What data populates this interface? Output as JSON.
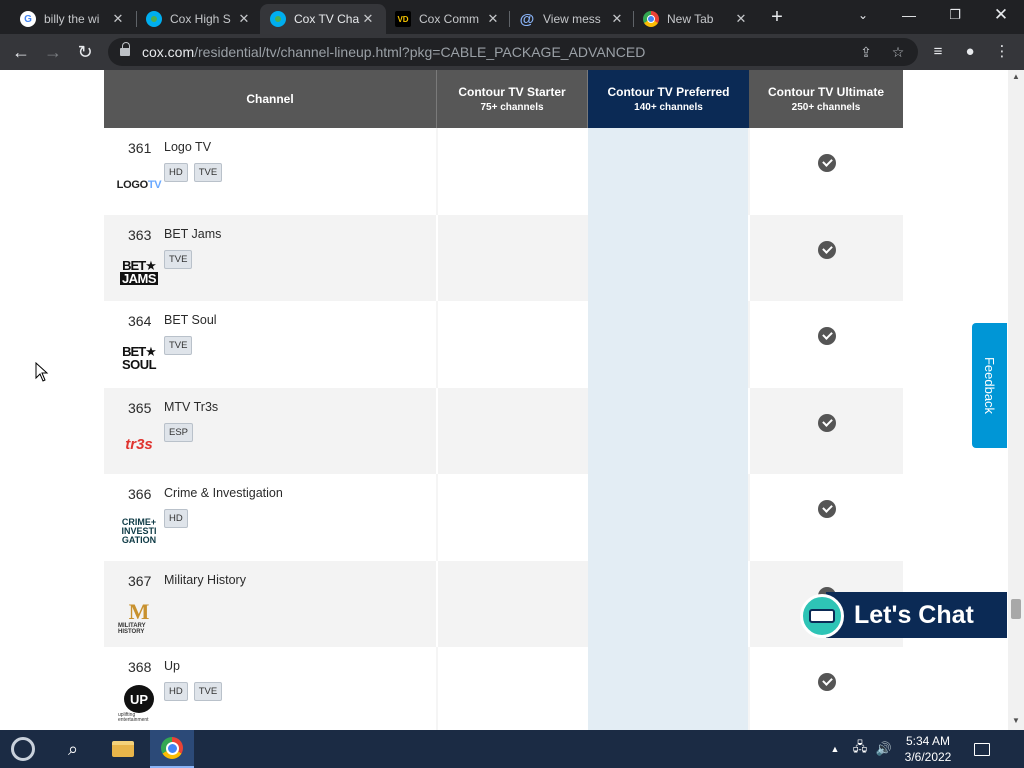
{
  "browser": {
    "tabs": [
      {
        "title": "billy the wi",
        "favicon": "google-icon",
        "active": false
      },
      {
        "title": "Cox High S",
        "favicon": "cox-icon",
        "active": false
      },
      {
        "title": "Cox TV Cha",
        "favicon": "cox-icon",
        "active": true
      },
      {
        "title": "Cox Comm",
        "favicon": "vd-icon",
        "active": false
      },
      {
        "title": "View mess",
        "favicon": "at-icon",
        "active": false
      },
      {
        "title": "New Tab",
        "favicon": "chrome-icon",
        "active": false
      }
    ],
    "url_host": "cox.com",
    "url_path": "/residential/tv/channel-lineup.html?pkg=CABLE_PACKAGE_ADVANCED"
  },
  "table": {
    "headers": {
      "channel": "Channel",
      "starter": {
        "name": "Contour TV Starter",
        "count": "75+ channels"
      },
      "preferred": {
        "name": "Contour TV Preferred",
        "count": "140+ channels"
      },
      "ultimate": {
        "name": "Contour TV Ultimate",
        "count": "250+ channels"
      }
    },
    "rows": [
      {
        "number": "361",
        "name": "Logo TV",
        "logo": "logo-tv-logo",
        "badges": [
          "HD",
          "TVE"
        ],
        "ultimate": true
      },
      {
        "number": "363",
        "name": "BET Jams",
        "logo": "bet-jams-logo",
        "badges": [
          "TVE"
        ],
        "ultimate": true
      },
      {
        "number": "364",
        "name": "BET Soul",
        "logo": "bet-soul-logo",
        "badges": [
          "TVE"
        ],
        "ultimate": true
      },
      {
        "number": "365",
        "name": "MTV Tr3s",
        "logo": "mtv-tr3s-logo",
        "badges": [
          "ESP"
        ],
        "ultimate": true
      },
      {
        "number": "366",
        "name": "Crime & Investigation",
        "logo": "crime-investigation-logo",
        "badges": [
          "HD"
        ],
        "ultimate": true
      },
      {
        "number": "367",
        "name": "Military History",
        "logo": "military-history-logo",
        "badges": [],
        "ultimate": true
      },
      {
        "number": "368",
        "name": "Up",
        "logo": "up-logo",
        "badges": [
          "HD",
          "TVE"
        ],
        "ultimate": true
      }
    ]
  },
  "widgets": {
    "feedback": "Feedback",
    "chat": "Let's Chat"
  },
  "taskbar": {
    "time": "5:34 AM",
    "date": "3/6/2022"
  },
  "colors": {
    "header_gray": "#575757",
    "preferred_navy": "#0b2a55",
    "preferred_column": "#e3edf4",
    "feedback_blue": "#0096d6"
  }
}
